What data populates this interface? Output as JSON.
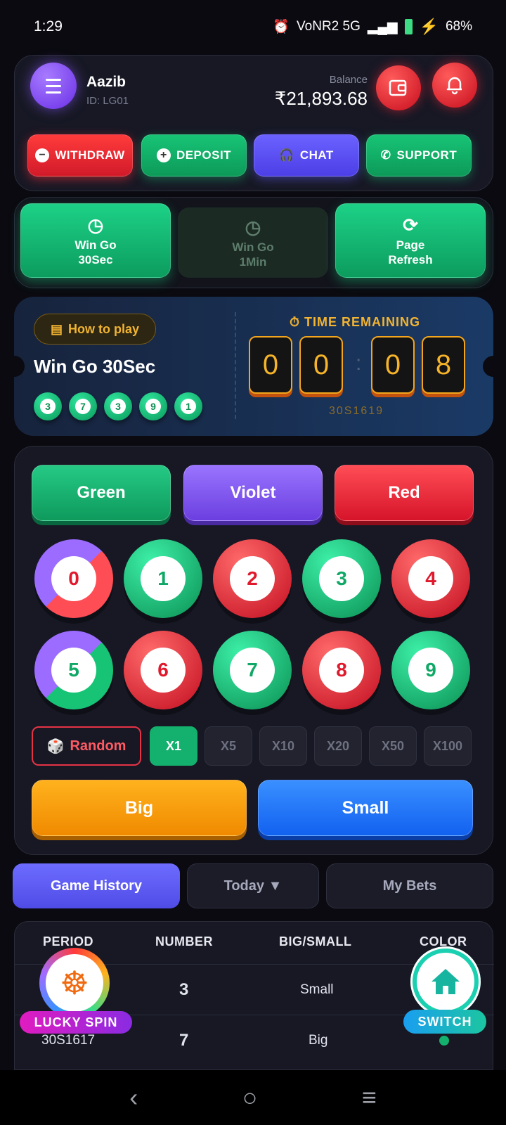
{
  "status_bar": {
    "time": "1:29",
    "network": "VoNR2 5G",
    "battery": "68%"
  },
  "user": {
    "name": "Aazib",
    "id": "ID: LG01"
  },
  "balance": {
    "label": "Balance",
    "value": "₹21,893.68"
  },
  "actions": {
    "withdraw": "WITHDRAW",
    "deposit": "DEPOSIT",
    "chat": "CHAT",
    "support": "SUPPORT"
  },
  "modes": [
    {
      "line1": "Win Go",
      "line2": "30Sec",
      "active": true
    },
    {
      "line1": "Win Go",
      "line2": "1Min",
      "active": false
    },
    {
      "line1": "Page",
      "line2": "Refresh",
      "active": true
    }
  ],
  "game": {
    "how_to_play": "How to play",
    "name": "Win Go 30Sec",
    "recent_results": [
      "3",
      "7",
      "3",
      "9",
      "1"
    ],
    "time_remaining_label": "TIME REMAINING",
    "timer_digits": [
      "0",
      "0",
      "0",
      "8"
    ],
    "period": "30S1619"
  },
  "colors": {
    "green": "Green",
    "violet": "Violet",
    "red": "Red"
  },
  "numbers": [
    "0",
    "1",
    "2",
    "3",
    "4",
    "5",
    "6",
    "7",
    "8",
    "9"
  ],
  "multipliers": {
    "random": "Random",
    "options": [
      "X1",
      "X5",
      "X10",
      "X20",
      "X50",
      "X100"
    ],
    "selected": "X1"
  },
  "size": {
    "big": "Big",
    "small": "Small"
  },
  "tabs": {
    "history": "Game History",
    "today": "Today ▼",
    "bets": "My Bets"
  },
  "history": {
    "headers": {
      "period": "PERIOD",
      "number": "NUMBER",
      "bigsmall": "BIG/SMALL",
      "color": "COLOR"
    },
    "rows": [
      {
        "period": "",
        "number": "3",
        "bigsmall": "Small",
        "color": "green"
      },
      {
        "period": "30S1617",
        "number": "7",
        "bigsmall": "Big",
        "color": "green"
      }
    ]
  },
  "floating": {
    "lucky_spin": "LUCKY SPIN",
    "switch": "SWITCH"
  },
  "theme": {
    "accent_green": "#14b06d",
    "accent_red": "#e0192d",
    "accent_violet": "#6b3fe0",
    "gold": "#f2b431"
  }
}
